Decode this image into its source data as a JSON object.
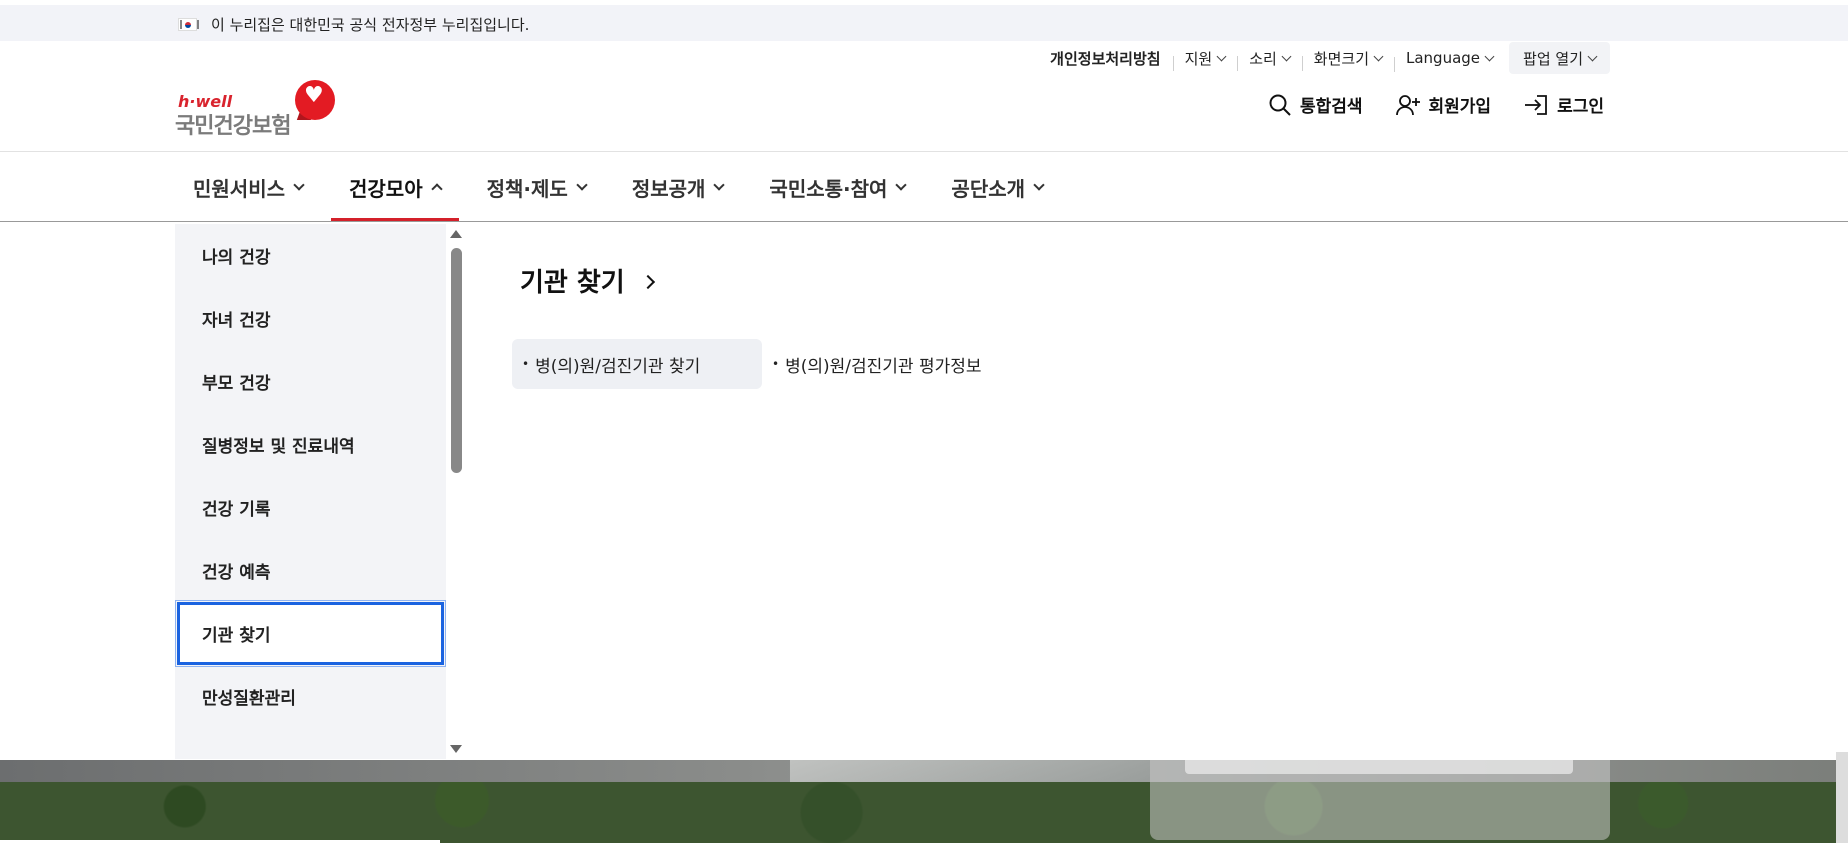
{
  "gov_banner": {
    "text": "이 누리집은 대한민국 공식 전자정부 누리집입니다."
  },
  "utility": {
    "privacy": "개인정보처리방침",
    "support": "지원",
    "sound": "소리",
    "screen_size": "화면크기",
    "language": "Language",
    "popup": "팝업 열기"
  },
  "logo": {
    "brand": "h·well",
    "name": "국민건강보험"
  },
  "actions": {
    "search": "통합검색",
    "signup": "회원가입",
    "login": "로그인"
  },
  "nav": [
    {
      "label": "민원서비스",
      "active": false
    },
    {
      "label": "건강모아",
      "active": true
    },
    {
      "label": "정책·제도",
      "active": false
    },
    {
      "label": "정보공개",
      "active": false
    },
    {
      "label": "국민소통·참여",
      "active": false
    },
    {
      "label": "공단소개",
      "active": false
    }
  ],
  "side_menu": [
    "나의 건강",
    "자녀 건강",
    "부모 건강",
    "질병정보 및 진료내역",
    "건강 기록",
    "건강 예측",
    "기관 찾기",
    "만성질환관리"
  ],
  "side_selected": "기관 찾기",
  "content": {
    "title": "기관 찾기",
    "links": [
      "병(의)원/검진기관 찾기",
      "병(의)원/검진기관 평가정보"
    ]
  },
  "colors": {
    "accent_red": "#d4202a",
    "focus_blue": "#1a63e0"
  }
}
